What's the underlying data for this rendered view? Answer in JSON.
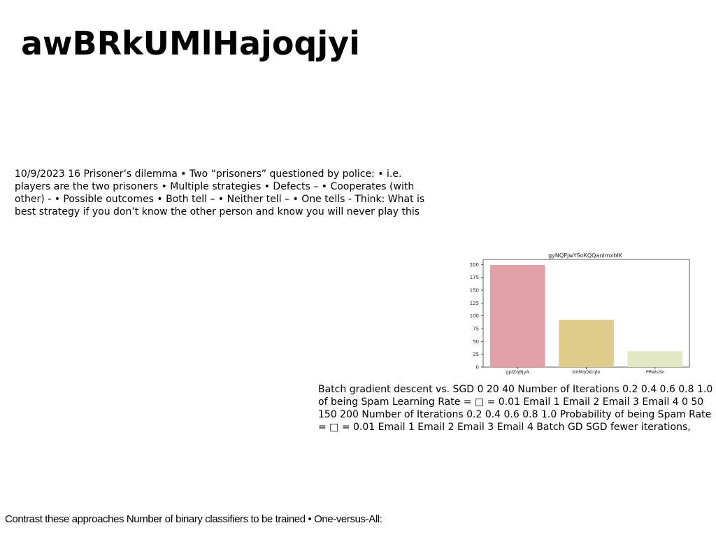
{
  "slide": {
    "title": "awBRkUMlHajoqjyi",
    "text_block_1": "10/9/2023 16 Prisoner’s dilemma • Two “prisoners” questioned by police: • i.e. players are the two prisoners • Multiple strategies • Defects – • Cooperates (with other) - • Possible outcomes • Both tell – • Neither tell – • One tells - Think: What is best strategy if you don’t know the other person and know you will never play this",
    "text_block_2": "Batch gradient descent vs. SGD 0 20 40 Number of Iterations 0.2 0.4 0.6 0.8 1.0 of being Spam Learning Rate = □ = 0.01 Email 1 Email 2 Email 3 Email 4 0 50 150 200 Number of Iterations 0.2 0.4 0.6 0.8 1.0 Probability of being Spam Rate = □ = 0.01 Email 1 Email 2 Email 3 Email 4 Batch GD SGD fewer iterations,",
    "text_block_3": "Contrast these approaches Number of binary classifiers to be trained • One-versus-All:"
  },
  "chart_data": {
    "type": "bar",
    "title": "gyNQPjwYSoKQQanlmxbIK",
    "categories": [
      "gplZqBJyA",
      "bXMqOktqlo",
      "PRWsSk"
    ],
    "values": [
      199,
      92,
      31
    ],
    "colors": [
      "#e0a0a6",
      "#dfcb8c",
      "#e2e8c4"
    ],
    "ylim": [
      0,
      210
    ],
    "yticks": [
      0,
      25,
      50,
      75,
      100,
      125,
      150,
      175,
      200
    ],
    "xlabel": "",
    "ylabel": "",
    "grid": false
  }
}
